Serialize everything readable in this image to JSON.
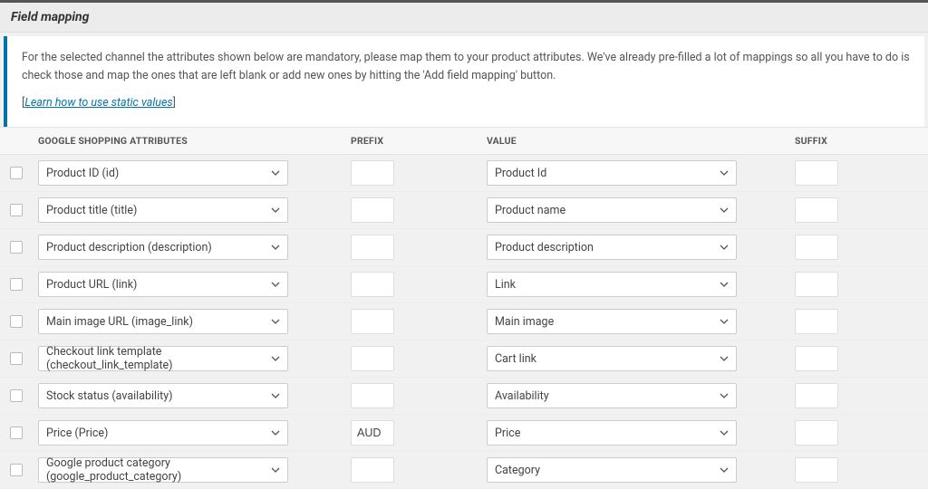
{
  "header": {
    "title": "Field mapping"
  },
  "info": {
    "text": "For the selected channel the attributes shown below are mandatory, please map them to your product attributes. We've already pre-filled a lot of mappings so all you have to do is check those and map the ones that are left blank or add new ones by hitting the 'Add field mapping' button.",
    "linkLabel": "Learn how to use static values"
  },
  "columns": {
    "attributes": "GOOGLE SHOPPING ATTRIBUTES",
    "prefix": "PREFIX",
    "value": "VALUE",
    "suffix": "SUFFIX"
  },
  "rows": [
    {
      "attribute": "Product ID (id)",
      "prefix": "",
      "value": "Product Id",
      "suffix": ""
    },
    {
      "attribute": "Product title (title)",
      "prefix": "",
      "value": "Product name",
      "suffix": ""
    },
    {
      "attribute": "Product description (description)",
      "prefix": "",
      "value": "Product description",
      "suffix": ""
    },
    {
      "attribute": "Product URL (link)",
      "prefix": "",
      "value": "Link",
      "suffix": ""
    },
    {
      "attribute": "Main image URL (image_link)",
      "prefix": "",
      "value": "Main image",
      "suffix": ""
    },
    {
      "attribute": "Checkout link template (checkout_link_template)",
      "prefix": "",
      "value": "Cart link",
      "suffix": ""
    },
    {
      "attribute": "Stock status (availability)",
      "prefix": "",
      "value": "Availability",
      "suffix": ""
    },
    {
      "attribute": "Price (Price)",
      "prefix": "AUD",
      "value": "Price",
      "suffix": ""
    },
    {
      "attribute": "Google product category (google_product_category)",
      "prefix": "",
      "value": "Category",
      "suffix": ""
    }
  ]
}
